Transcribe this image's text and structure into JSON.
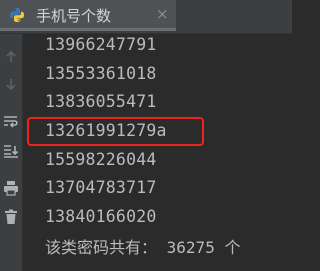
{
  "tab": {
    "title": "手机号个数",
    "close": "×"
  },
  "toolbar": {
    "icons": [
      "arrow-up-icon",
      "arrow-down-icon",
      "soft-wrap-icon",
      "scroll-to-end-icon",
      "print-icon",
      "trash-icon"
    ]
  },
  "output": {
    "lines": [
      "13966247791",
      "13553361018",
      "13836055471",
      "13261991279a",
      "15598226044",
      "13704783717",
      "13840166020"
    ],
    "highlighted_index": 3,
    "summary": {
      "label": "该类密码共有：",
      "value": "36275",
      "unit": "个"
    }
  },
  "colors": {
    "background": "#2b2b2b",
    "text": "#b9bcbe",
    "highlight": "#e8261f"
  }
}
